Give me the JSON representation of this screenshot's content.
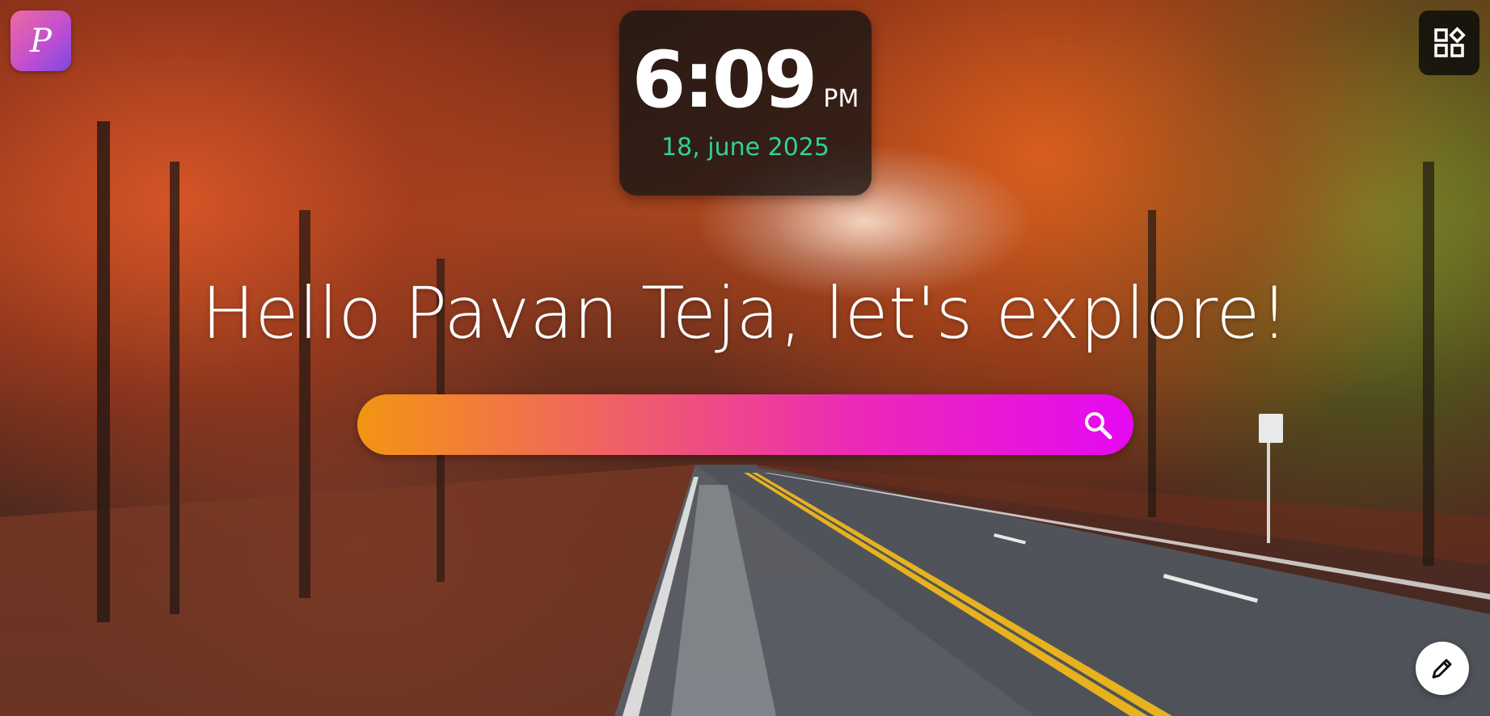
{
  "logo": {
    "letter": "P"
  },
  "clock": {
    "time": "6:09",
    "ampm": "PM",
    "date": "18, june 2025"
  },
  "greeting": "Hello Pavan Teja, let's explore!",
  "search": {
    "placeholder": "",
    "value": ""
  },
  "icons": {
    "apps": "apps-grid-icon",
    "search": "search-icon",
    "edit": "pencil-icon"
  },
  "colors": {
    "date": "#2fd19b",
    "search_gradient_start": "#f39512",
    "search_gradient_end": "#e509f2",
    "logo_gradient_start": "#f06ba0",
    "logo_gradient_end": "#7b49e3"
  }
}
